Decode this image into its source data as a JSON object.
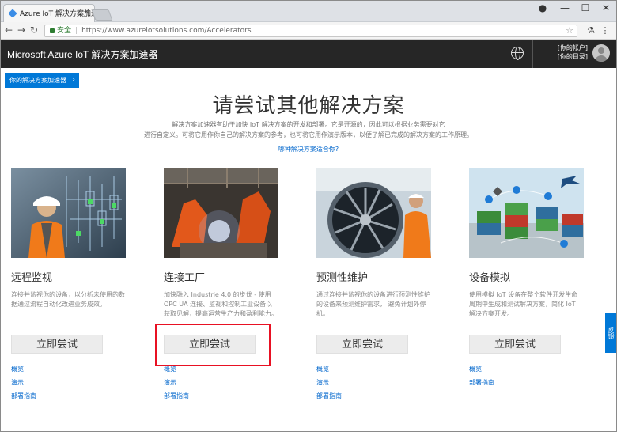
{
  "browser": {
    "tab_title": "Azure IoT 解决方案加速器",
    "tab_close": "✕",
    "window_controls": {
      "account": "●",
      "minimize": "—",
      "maximize": "☐",
      "close": "✕"
    },
    "nav": {
      "back": "←",
      "forward": "→",
      "reload": "↻"
    },
    "secure_label": "安全",
    "url": "https://www.azureiotsolutions.com/Accelerators",
    "star": "☆"
  },
  "header": {
    "title": "Microsoft Azure IoT 解决方案加速器",
    "account_line1": "[你的帐户]",
    "account_line2": "[你的目录]"
  },
  "breadcrumb": {
    "label": "你的解决方案加速器",
    "chevron": "›"
  },
  "main": {
    "title": "请尝试其他解决方案",
    "description_line1": "解决方案加速器有助于加快 IoT 解决方案的开发和部署。它是开源的，因此可以根据业务需要对它",
    "description_line2": "进行自定义。可将它用作你自己的解决方案的参考，也可将它用作演示版本，以便了解已完成的解决方案的工作原理。",
    "which_link": "哪种解决方案适合你?"
  },
  "cards": [
    {
      "title": "远程监视",
      "description": "连接并监视你的设备，以分析未使用的数据通过流程自动化改进业务成效。",
      "button": "立即尝试",
      "links": [
        "概览",
        "演示",
        "部署指南"
      ]
    },
    {
      "title": "连接工厂",
      "description": "加快融入 Industrie 4.0 的步伐 - 使用 OPC UA 连接、监视和控制工业设备以获取见解，提高运营生产力和盈利能力。",
      "button": "立即尝试",
      "links": [
        "概览",
        "演示",
        "部署指南"
      ]
    },
    {
      "title": "预测性维护",
      "description": "通过连接并监视你的设备进行预测性维护的设备来预测维护需求， 避免计划外停机。",
      "button": "立即尝试",
      "links": [
        "概览",
        "演示",
        "部署指南"
      ]
    },
    {
      "title": "设备模拟",
      "description": "使用模拟 IoT 设备在整个软件开发生命周期中生成和测试解决方案，简化 IoT 解决方案开发。",
      "button": "立即尝试",
      "links": [
        "概览",
        "部署指南"
      ]
    }
  ],
  "feedback": "反馈",
  "colors": {
    "header_bg": "#262626",
    "accent_blue": "#0078d7",
    "link_blue": "#0066cc",
    "highlight_red": "#e81123",
    "button_gray": "#ececec"
  }
}
